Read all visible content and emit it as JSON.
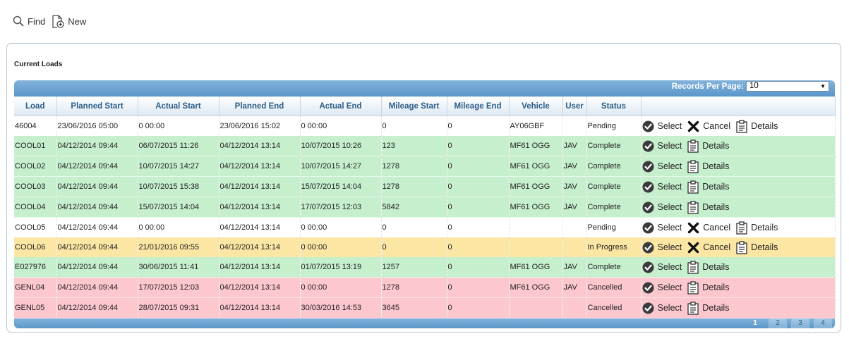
{
  "toolbar": {
    "find_label": "Find",
    "new_label": "New"
  },
  "panel": {
    "title": "Current Loads"
  },
  "grid": {
    "records_per_page_label": "Records Per Page:",
    "records_per_page_value": "10",
    "columns": [
      "Load",
      "Planned Start",
      "Actual Start",
      "Planned End",
      "Actual End",
      "Mileage Start",
      "Mileage End",
      "Vehicle",
      "User",
      "Status",
      ""
    ],
    "action_labels": {
      "select": "Select",
      "cancel": "Cancel",
      "details": "Details"
    },
    "rows": [
      {
        "load": "46004",
        "planned_start": "23/06/2016 05:00",
        "actual_start": "0 00:00",
        "planned_end": "23/06/2016 15:02",
        "actual_end": "0 00:00",
        "mileage_start": "0",
        "mileage_end": "0",
        "vehicle": "AY06GBF",
        "user": "",
        "status": "Pending",
        "color": "white",
        "cancel": true
      },
      {
        "load": "COOL01",
        "planned_start": "04/12/2014 09:44",
        "actual_start": "06/07/2015 11:26",
        "planned_end": "04/12/2014 13:14",
        "actual_end": "10/07/2015 10:26",
        "mileage_start": "123",
        "mileage_end": "0",
        "vehicle": "MF61 OGG",
        "user": "JAV",
        "status": "Complete",
        "color": "green",
        "cancel": false
      },
      {
        "load": "COOL02",
        "planned_start": "04/12/2014 09:44",
        "actual_start": "10/07/2015 14:27",
        "planned_end": "04/12/2014 13:14",
        "actual_end": "10/07/2015 14:27",
        "mileage_start": "1278",
        "mileage_end": "0",
        "vehicle": "MF61 OGG",
        "user": "JAV",
        "status": "Complete",
        "color": "green",
        "cancel": false
      },
      {
        "load": "COOL03",
        "planned_start": "04/12/2014 09:44",
        "actual_start": "10/07/2015 15:38",
        "planned_end": "04/12/2014 13:14",
        "actual_end": "15/07/2015 14:04",
        "mileage_start": "1278",
        "mileage_end": "0",
        "vehicle": "MF61 OGG",
        "user": "JAV",
        "status": "Complete",
        "color": "green",
        "cancel": false
      },
      {
        "load": "COOL04",
        "planned_start": "04/12/2014 09:44",
        "actual_start": "15/07/2015 14:04",
        "planned_end": "04/12/2014 13:14",
        "actual_end": "17/07/2015 12:03",
        "mileage_start": "5842",
        "mileage_end": "0",
        "vehicle": "MF61 OGG",
        "user": "JAV",
        "status": "Complete",
        "color": "green",
        "cancel": false
      },
      {
        "load": "COOL05",
        "planned_start": "04/12/2014 09:44",
        "actual_start": "0 00:00",
        "planned_end": "04/12/2014 13:14",
        "actual_end": "0 00:00",
        "mileage_start": "0",
        "mileage_end": "0",
        "vehicle": "",
        "user": "",
        "status": "Pending",
        "color": "white",
        "cancel": true
      },
      {
        "load": "COOL06",
        "planned_start": "04/12/2014 09:44",
        "actual_start": "21/01/2016 09:55",
        "planned_end": "04/12/2014 13:14",
        "actual_end": "0 00:00",
        "mileage_start": "0",
        "mileage_end": "0",
        "vehicle": "",
        "user": "",
        "status": "In Progress",
        "color": "yellow",
        "cancel": true
      },
      {
        "load": "E027976",
        "planned_start": "04/12/2014 09:44",
        "actual_start": "30/06/2015 11:41",
        "planned_end": "04/12/2014 13:14",
        "actual_end": "01/07/2015 13:19",
        "mileage_start": "1257",
        "mileage_end": "0",
        "vehicle": "MF61 OGG",
        "user": "JAV",
        "status": "Complete",
        "color": "green",
        "cancel": false
      },
      {
        "load": "GENL04",
        "planned_start": "04/12/2014 09:44",
        "actual_start": "17/07/2015 12:03",
        "planned_end": "04/12/2014 13:14",
        "actual_end": "0 00:00",
        "mileage_start": "1278",
        "mileage_end": "0",
        "vehicle": "MF61 OGG",
        "user": "JAV",
        "status": "Cancelled",
        "color": "red",
        "cancel": false
      },
      {
        "load": "GENL05",
        "planned_start": "04/12/2014 09:44",
        "actual_start": "28/07/2015 09:31",
        "planned_end": "04/12/2014 13:14",
        "actual_end": "30/03/2016 14:53",
        "mileage_start": "3645",
        "mileage_end": "0",
        "vehicle": "",
        "user": "",
        "status": "Cancelled",
        "color": "red",
        "cancel": false
      }
    ],
    "pages": [
      "1",
      "2",
      "3",
      "4"
    ],
    "current_page": "1"
  }
}
